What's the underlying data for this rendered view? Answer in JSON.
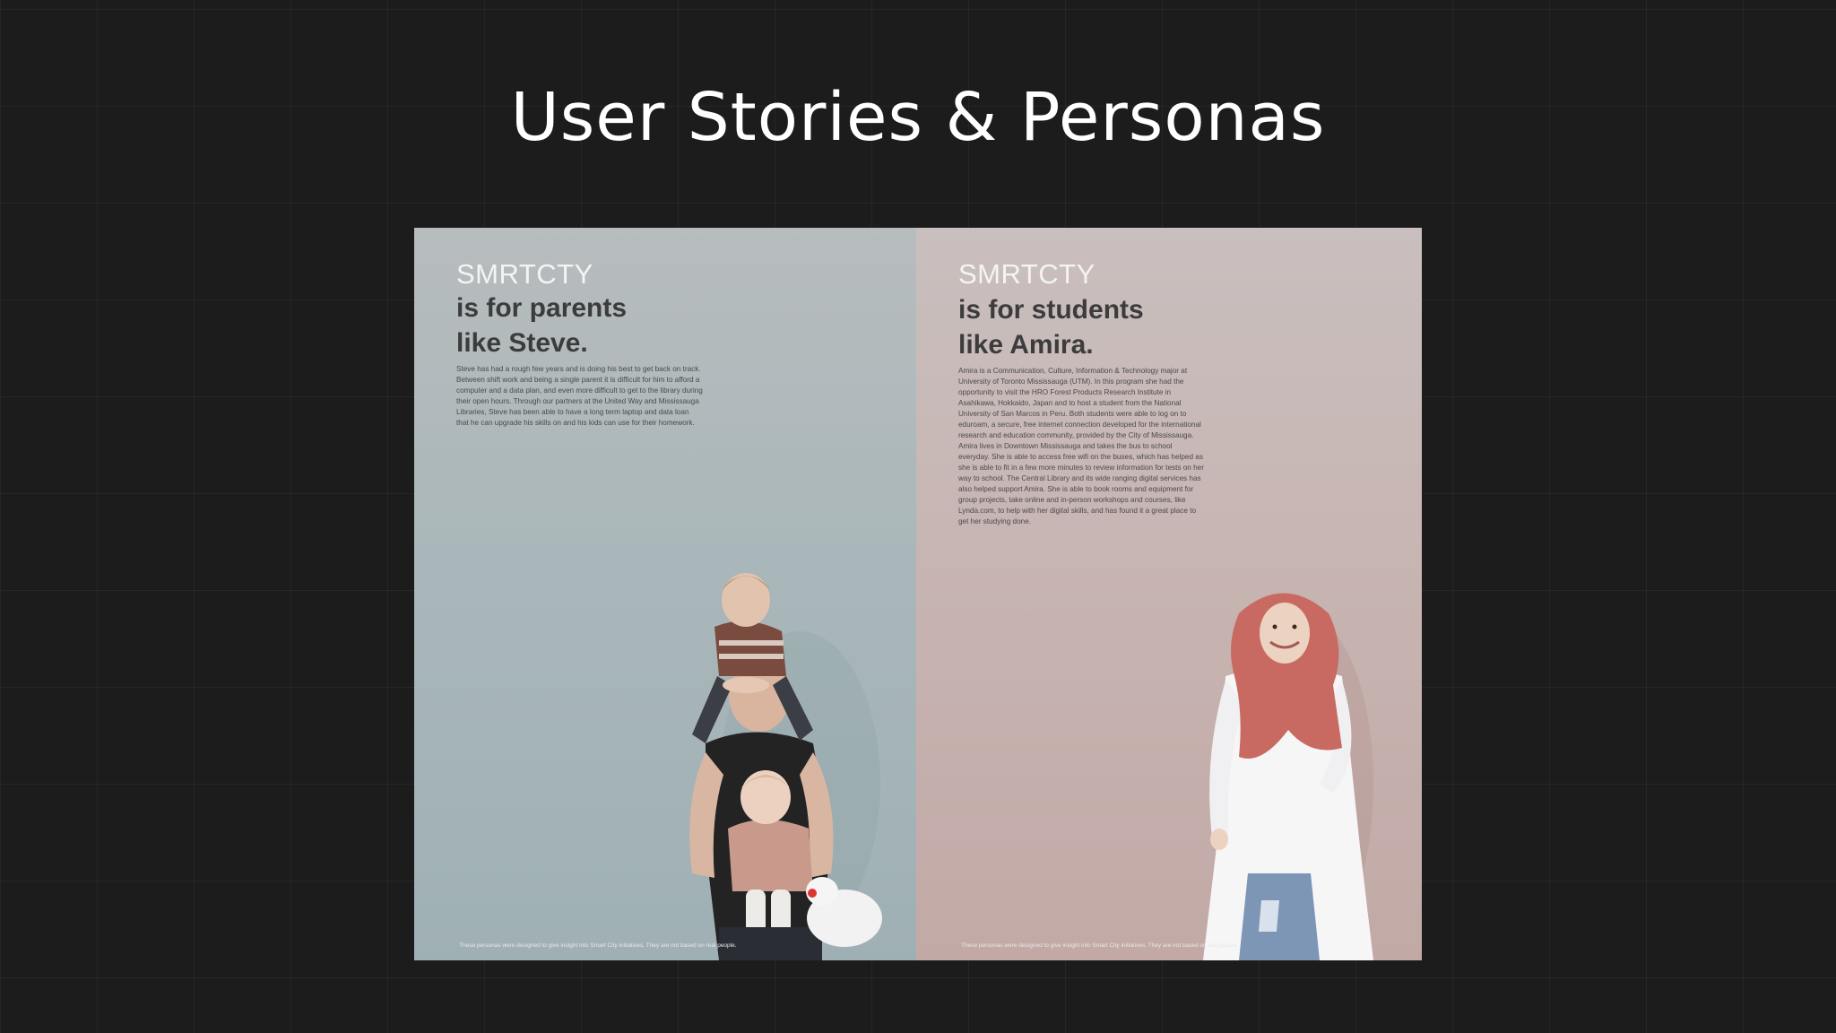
{
  "slide": {
    "title": "User Stories & Personas"
  },
  "personas": [
    {
      "brand": "SMRTCTY",
      "headline_line1": "is for parents",
      "headline_line2": "like Steve.",
      "story": "Steve has had a rough few years and is doing his best to get back on track. Between shift work and being a single parent it is difficult for him to afford a computer and a data plan, and even more difficult to get to the library during their open hours. Through our partners at the United Way and Mississauga Libraries, Steve has been able to have a long term laptop and data loan that he can upgrade his skills on and his kids can use for their homework.",
      "disclaimer": "These personas were designed to give insight into Smart City initiatives. They are not based on real people.",
      "photo": "father-with-two-children-photo"
    },
    {
      "brand": "SMRTCTY",
      "headline_line1": "is for students",
      "headline_line2": "like Amira.",
      "story": "Amira is a Communication, Culture, Information & Technology major at University of Toronto Mississauga (UTM). In this program she had the opportunity to visit the HRO Forest Products Research Institute in Asahikawa, Hokkaido, Japan and to host a student from the National University of San Marcos in Peru. Both students were able to log on to eduroam, a secure, free internet connection developed for the international research and education community, provided by the City of Mississauga. Amira lives in Downtown Mississauga and takes the bus to school everyday. She is able to access free wifi on the buses, which has helped as she is able to fit in a few more minutes to review information for tests on her way to school. The Central Library and its wide ranging digital services has also helped support Amira. She is able to book rooms and equipment for group projects, take online and in-person workshops and courses, like Lynda.com, to help with her digital skills, and has found it a great place to get her studying done.",
      "disclaimer": "These personas were designed to give insight into Smart City initiatives. They are not based on real people.",
      "photo": "student-in-hijab-photo"
    }
  ]
}
